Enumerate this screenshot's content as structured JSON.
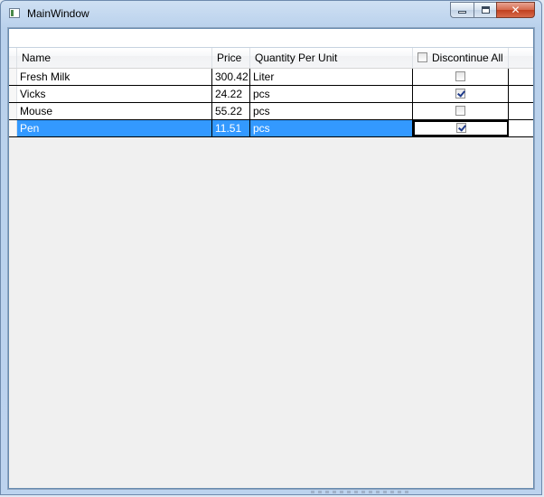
{
  "window": {
    "title": "MainWindow",
    "icon": "app-window-icon",
    "controls": [
      "minimize-icon",
      "maximize-icon",
      "close-icon"
    ]
  },
  "grid": {
    "columns": {
      "name": "Name",
      "price": "Price",
      "quantity": "Quantity Per Unit",
      "discontinue_all": "Discontinue All"
    },
    "discontinue_all_checked": false,
    "rows": [
      {
        "name": "Fresh Milk",
        "price": "300.42",
        "quantity": "Liter",
        "discontinued": false,
        "selected": false
      },
      {
        "name": "Vicks",
        "price": "24.22",
        "quantity": "pcs",
        "discontinued": true,
        "selected": false
      },
      {
        "name": "Mouse",
        "price": "55.22",
        "quantity": "pcs",
        "discontinued": false,
        "selected": false
      },
      {
        "name": "Pen",
        "price": "11.51",
        "quantity": "pcs",
        "discontinued": true,
        "selected": true
      }
    ]
  },
  "colors": {
    "selection": "#3399ff",
    "grid_border": "#688caf"
  }
}
